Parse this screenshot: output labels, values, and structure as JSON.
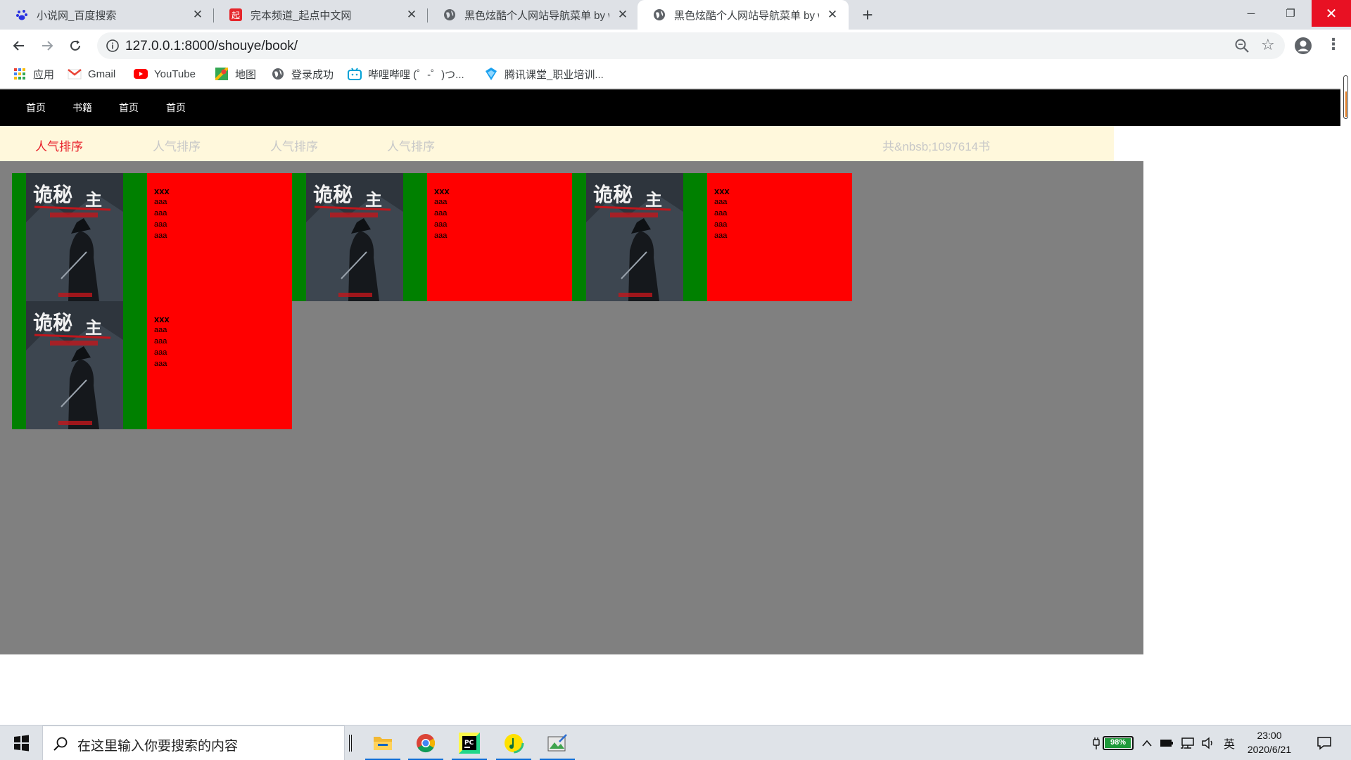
{
  "browser": {
    "tabs": [
      {
        "title": "小说网_百度搜索",
        "favicon": "baidu-paw-icon",
        "active": false
      },
      {
        "title": "完本频道_起点中文网",
        "favicon": "qidian-icon",
        "active": false
      },
      {
        "title": "黑色炫酷个人网站导航菜单 by w",
        "favicon": "globe-icon",
        "active": false
      },
      {
        "title": "黑色炫酷个人网站导航菜单 by w",
        "favicon": "globe-icon",
        "active": true
      }
    ],
    "new_tab_icon": "+",
    "url": "127.0.0.1:8000/shouye/book/",
    "bookmarks": [
      {
        "label": "应用",
        "icon": "apps-grid-icon"
      },
      {
        "label": "Gmail",
        "icon": "gmail-icon"
      },
      {
        "label": "YouTube",
        "icon": "youtube-icon"
      },
      {
        "label": "地图",
        "icon": "maps-icon"
      },
      {
        "label": "登录成功",
        "icon": "globe-icon"
      },
      {
        "label": "哔哩哔哩 (゜-゜)つ...",
        "icon": "bilibili-icon"
      },
      {
        "label": "腾讯课堂_职业培训...",
        "icon": "tencent-classroom-icon"
      }
    ]
  },
  "site": {
    "nav": [
      "首页",
      "书籍",
      "首页",
      "首页"
    ],
    "sort_tabs": [
      "人气排序",
      "人气排序",
      "人气排序",
      "人气排序"
    ],
    "total_label": "共&nbsb;1097614书",
    "colors": {
      "nav_bg": "#000000",
      "sort_bg": "#fff8dc",
      "active": "#e8232d",
      "area_bg": "#808080",
      "card_left": "#008000",
      "card_right": "#ff0000"
    },
    "books": [
      {
        "title": "xxx",
        "lines": [
          "aaa",
          "aaa",
          "aaa",
          "aaa"
        ]
      },
      {
        "title": "xxx",
        "lines": [
          "aaa",
          "aaa",
          "aaa",
          "aaa"
        ]
      },
      {
        "title": "xxx",
        "lines": [
          "aaa",
          "aaa",
          "aaa",
          "aaa"
        ]
      },
      {
        "title": "xxx",
        "lines": [
          "aaa",
          "aaa",
          "aaa",
          "aaa"
        ]
      }
    ]
  },
  "taskbar": {
    "search_placeholder": "在这里输入你要搜索的内容",
    "battery": "98%",
    "battery_level": 0.98,
    "ime": "英",
    "time": "23:00",
    "date": "2020/6/21"
  }
}
